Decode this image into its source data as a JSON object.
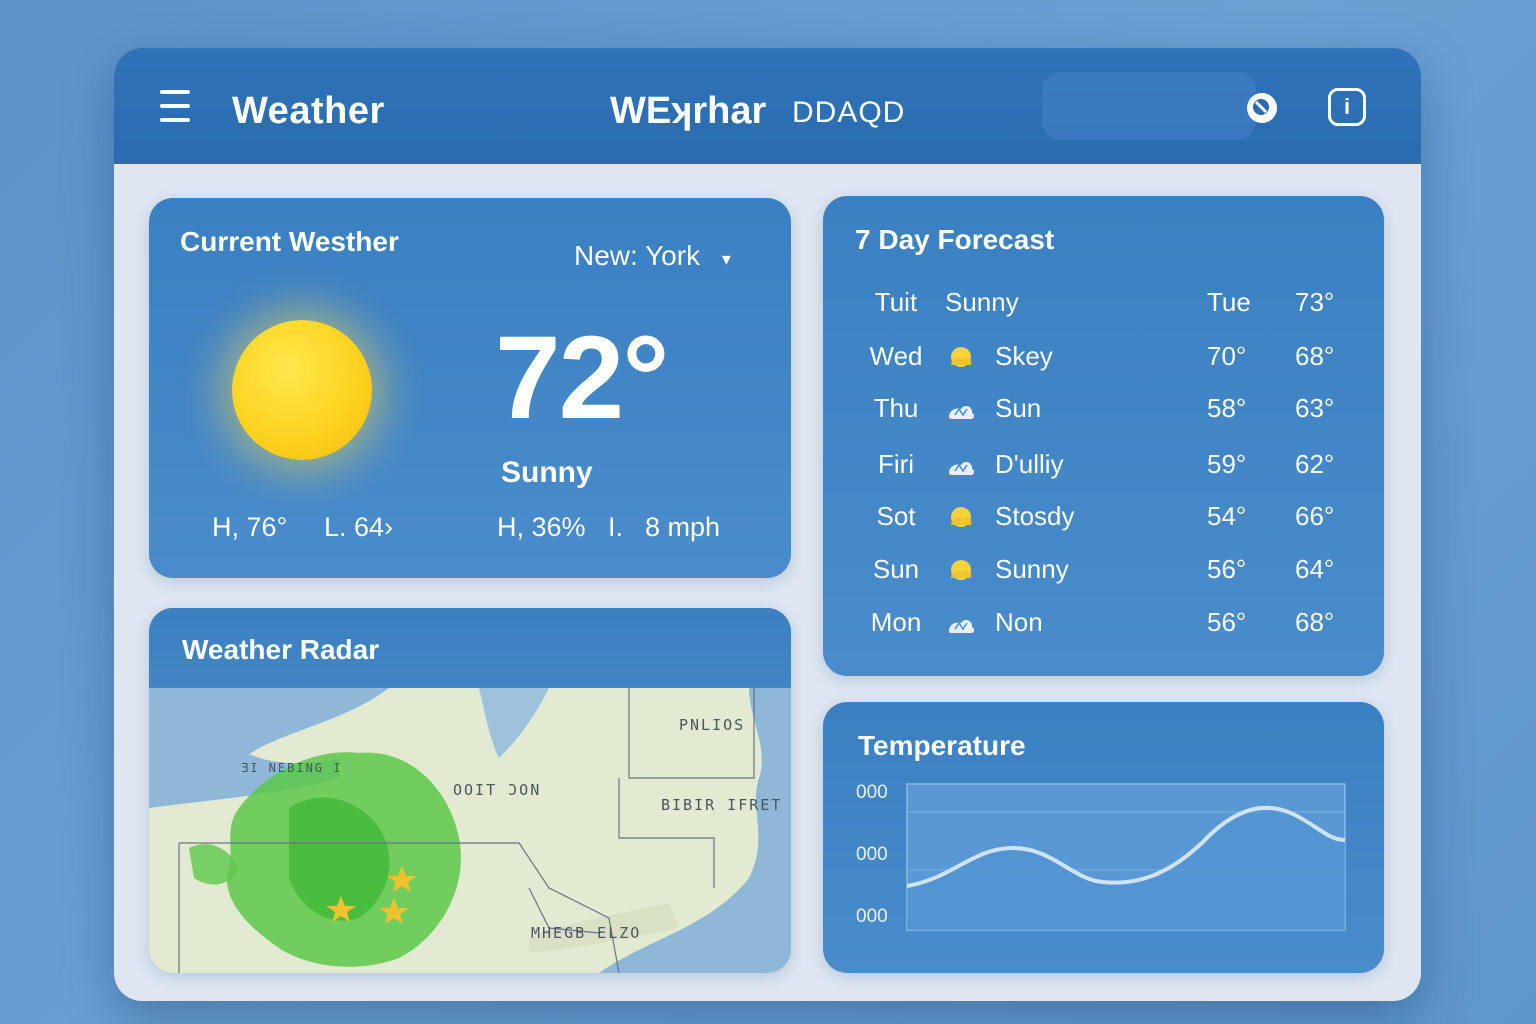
{
  "header": {
    "app_title": "Weather",
    "center_title": "WEʞrhar",
    "center_subtitle": "DDAQD",
    "search_placeholder": ""
  },
  "current": {
    "title": "Current Westher",
    "location": "New:  York",
    "location_arrow": "▾",
    "temperature": "72°",
    "condition": "Sunny",
    "high": "H, 76°",
    "low": "L. 64›",
    "humidity": "H, 36%",
    "wind_label": "I.",
    "wind": "8 mph",
    "icon": "sun-icon"
  },
  "forecast": {
    "title": "7  Day Forecast",
    "days": [
      {
        "day": "Tuit",
        "desc": "Sunny",
        "t1": "Tue",
        "t2": "73°",
        "icon": "none"
      },
      {
        "day": "Wed",
        "desc": "Skey",
        "t1": "70°",
        "t2": "68°",
        "icon": "sun-cloud-icon"
      },
      {
        "day": "Thu",
        "desc": "Sun",
        "t1": "58°",
        "t2": "63°",
        "icon": "cloud-icon"
      },
      {
        "day": "Firi",
        "desc": "D'ulliy",
        "t1": "59°",
        "t2": "62°",
        "icon": "cloud-icon"
      },
      {
        "day": "Sot",
        "desc": "Stosdy",
        "t1": "54°",
        "t2": "66°",
        "icon": "sun-cloud-icon"
      },
      {
        "day": "Sun",
        "desc": "Sunny",
        "t1": "56°",
        "t2": "64°",
        "icon": "sun-cloud-icon"
      },
      {
        "day": "Mon",
        "desc": "Non",
        "t1": "56°",
        "t2": "68°",
        "icon": "cloud-icon"
      }
    ]
  },
  "radar": {
    "title": "Weather Radar",
    "labels": [
      "PNLIOS",
      "ƎI NEBING I",
      "OOIT ƆON",
      "BIBIR IFRET",
      "MHEGB ELZO"
    ]
  },
  "temperature": {
    "title": "Temperature",
    "y_labels": [
      "000",
      "000",
      "000"
    ]
  },
  "colors": {
    "header": "#2b6cb0",
    "card": "#3f85c6",
    "panel": "#dde6f1",
    "sun": "#fcd11e",
    "radar_rain": "#5cc84a"
  }
}
